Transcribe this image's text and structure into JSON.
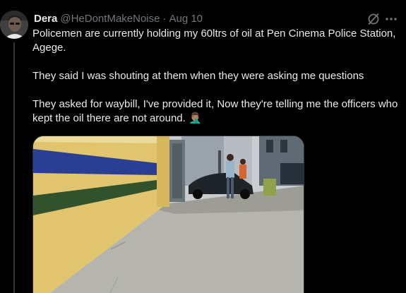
{
  "tweet": {
    "author": {
      "display_name": "Dera",
      "handle": "@HeDontMakeNoise",
      "separator": "·",
      "timestamp": "Aug 10",
      "avatar_icon": "avatar-photo"
    },
    "text_lines": [
      "Policemen are currently holding my 60ltrs of oil at Pen Cinema Police Station, Agege.",
      "They said I was shouting at them when they were asking me questions",
      "They asked for waybill, I've provided it, Now they're telling me the officers who kept the oil there are not around. 🤦🏽‍♂️"
    ],
    "header_icons": {
      "grok": "grok-icon",
      "more": "more-icon"
    },
    "media": {
      "type": "photo",
      "icon": "photo"
    },
    "colors": {
      "background": "#000000",
      "text_primary": "#e7e9ea",
      "text_secondary": "#71767b",
      "border": "#2f3336"
    }
  }
}
